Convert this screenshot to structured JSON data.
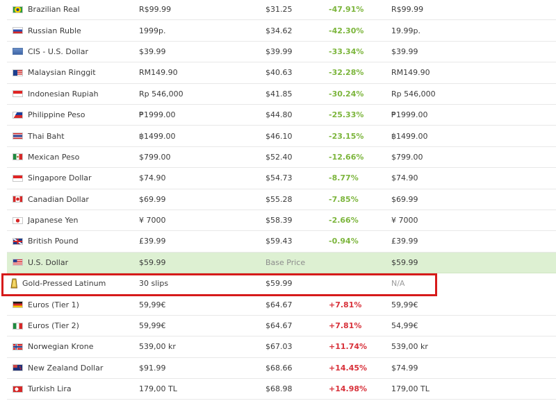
{
  "rows": [
    {
      "flag": "brazil-flag-icon",
      "name": "Brazilian Real",
      "local": "R$99.99",
      "usd": "$31.25",
      "diff": "-47.91%",
      "other": "R$99.99"
    },
    {
      "flag": "russia-flag-icon",
      "name": "Russian Ruble",
      "local": "1999p.",
      "usd": "$34.62",
      "diff": "-42.30%",
      "other": "19.99p."
    },
    {
      "flag": "cis-flag-icon",
      "name": "CIS - U.S. Dollar",
      "local": "$39.99",
      "usd": "$39.99",
      "diff": "-33.34%",
      "other": "$39.99"
    },
    {
      "flag": "malaysia-flag-icon",
      "name": "Malaysian Ringgit",
      "local": "RM149.90",
      "usd": "$40.63",
      "diff": "-32.28%",
      "other": "RM149.90"
    },
    {
      "flag": "indonesia-flag-icon",
      "name": "Indonesian Rupiah",
      "local": "Rp 546,000",
      "usd": "$41.85",
      "diff": "-30.24%",
      "other": "Rp 546,000"
    },
    {
      "flag": "philippines-flag-icon",
      "name": "Philippine Peso",
      "local": "₱1999.00",
      "usd": "$44.80",
      "diff": "-25.33%",
      "other": "₱1999.00"
    },
    {
      "flag": "thailand-flag-icon",
      "name": "Thai Baht",
      "local": "฿1499.00",
      "usd": "$46.10",
      "diff": "-23.15%",
      "other": "฿1499.00"
    },
    {
      "flag": "mexico-flag-icon",
      "name": "Mexican Peso",
      "local": "$799.00",
      "usd": "$52.40",
      "diff": "-12.66%",
      "other": "$799.00"
    },
    {
      "flag": "singapore-flag-icon",
      "name": "Singapore Dollar",
      "local": "$74.90",
      "usd": "$54.73",
      "diff": "-8.77%",
      "other": "$74.90"
    },
    {
      "flag": "canada-flag-icon",
      "name": "Canadian Dollar",
      "local": "$69.99",
      "usd": "$55.28",
      "diff": "-7.85%",
      "other": "$69.99"
    },
    {
      "flag": "japan-flag-icon",
      "name": "Japanese Yen",
      "local": "¥ 7000",
      "usd": "$58.39",
      "diff": "-2.66%",
      "other": "¥ 7000"
    },
    {
      "flag": "uk-flag-icon",
      "name": "British Pound",
      "local": "£39.99",
      "usd": "$59.43",
      "diff": "-0.94%",
      "other": "£39.99"
    },
    {
      "flag": "us-flag-icon",
      "name": "U.S. Dollar",
      "local": "$59.99",
      "usd": "Base Price",
      "diff": "",
      "other": "$59.99",
      "base": true
    },
    {
      "flag": "gold-bar-icon",
      "name": "Gold-Pressed Latinum",
      "local": "30 slips",
      "usd": "$59.99",
      "diff": "",
      "other": "N/A",
      "highlight": true
    },
    {
      "flag": "germany-flag-icon",
      "name": "Euros (Tier 1)",
      "local": "59,99€",
      "usd": "$64.67",
      "diff": "+7.81%",
      "other": "59,99€"
    },
    {
      "flag": "italy-flag-icon",
      "name": "Euros (Tier 2)",
      "local": "59,99€",
      "usd": "$64.67",
      "diff": "+7.81%",
      "other": "54,99€"
    },
    {
      "flag": "norway-flag-icon",
      "name": "Norwegian Krone",
      "local": "539,00 kr",
      "usd": "$67.03",
      "diff": "+11.74%",
      "other": "539,00 kr"
    },
    {
      "flag": "new-zealand-flag-icon",
      "name": "New Zealand Dollar",
      "local": "$91.99",
      "usd": "$68.66",
      "diff": "+14.45%",
      "other": "$74.99"
    },
    {
      "flag": "turkey-flag-icon",
      "name": "Turkish Lira",
      "local": "179,00 TL",
      "usd": "$68.98",
      "diff": "+14.98%",
      "other": "179,00 TL"
    }
  ],
  "colors": {
    "negative": "#7cb53c",
    "positive": "#d8313a",
    "base_row_bg": "#ddf0d2",
    "highlight_border": "#d61a1a"
  }
}
